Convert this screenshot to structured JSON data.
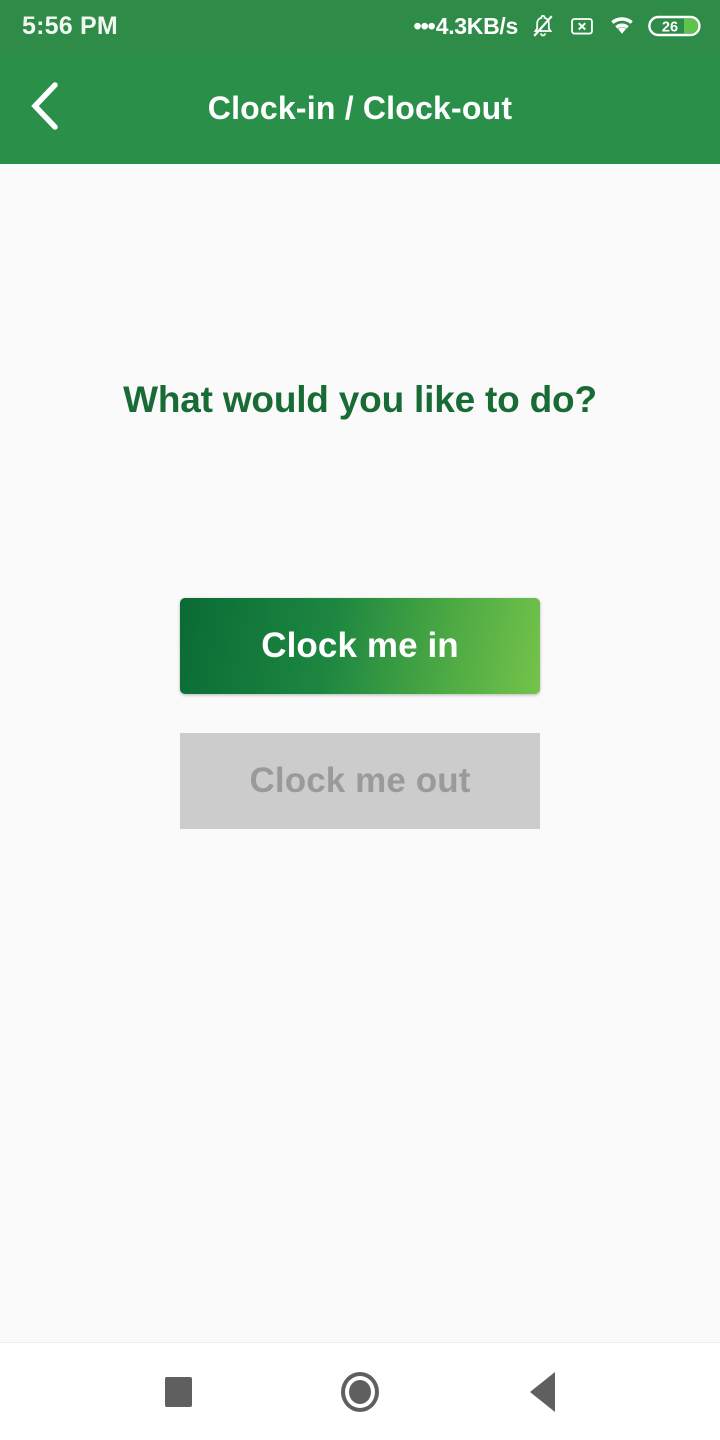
{
  "status_bar": {
    "time": "5:56 PM",
    "network_speed": "4.3KB/s",
    "network_dots": "•••",
    "icons": [
      "bell-muted-icon",
      "sim-no-card-icon",
      "wifi-icon",
      "battery-icon"
    ],
    "battery_level": "26",
    "background_color": "#2e8b48"
  },
  "app_bar": {
    "title": "Clock-in / Clock-out",
    "back_icon": "chevron-left-icon",
    "background_color": "#2a9049"
  },
  "main": {
    "heading": "What would you like to do?",
    "heading_color": "#196b36",
    "buttons": [
      {
        "label": "Clock me in",
        "state": "enabled",
        "gradient_from": "#0a6b35",
        "gradient_to": "#74c34a",
        "text_color": "#ffffff"
      },
      {
        "label": "Clock me out",
        "state": "disabled",
        "background_color": "#cccccc",
        "text_color": "#9a9a9a"
      }
    ],
    "background_color": "#fafafa"
  },
  "nav_bar": {
    "items": [
      {
        "name": "recents",
        "icon": "square-icon"
      },
      {
        "name": "home",
        "icon": "circle-icon"
      },
      {
        "name": "back",
        "icon": "triangle-left-icon"
      }
    ],
    "icon_color": "#5f5f5f",
    "background_color": "#ffffff"
  }
}
